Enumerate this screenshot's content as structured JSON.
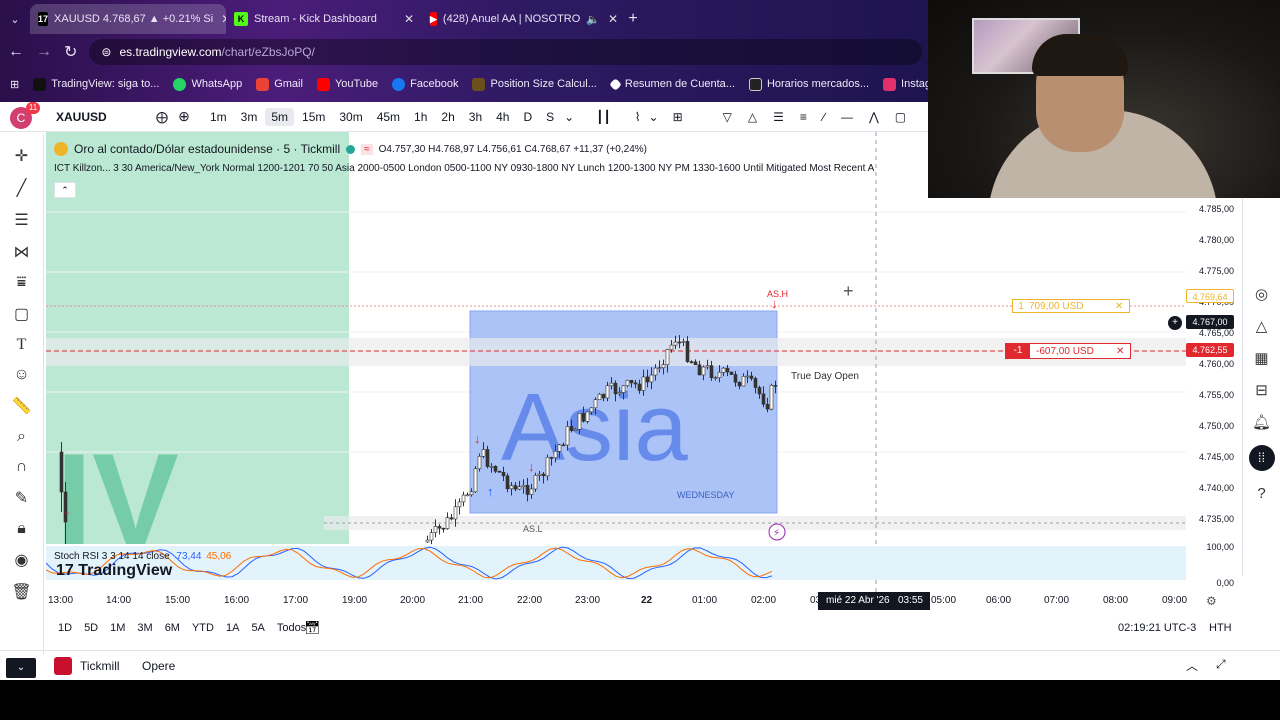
{
  "browser": {
    "tabs": [
      {
        "label": "XAUUSD 4.768,67 ▲ +0.21% Si",
        "icon": "TV",
        "active": true
      },
      {
        "label": "Stream - Kick Dashboard",
        "icon": "K",
        "active": false
      },
      {
        "label": "(428) Anuel AA | NOSOTRO",
        "icon": "YT",
        "active": false
      }
    ],
    "url_host": "es.tradingview.com",
    "url_path": "/chart/eZbsJoPQ/",
    "bookmarks": [
      {
        "label": "TradingView: siga to...",
        "icon": "tradingview-icon",
        "color": "#111111"
      },
      {
        "label": "WhatsApp",
        "icon": "whatsapp-icon",
        "color": "#25d366"
      },
      {
        "label": "Gmail",
        "icon": "gmail-icon",
        "color": "#ea4335"
      },
      {
        "label": "YouTube",
        "icon": "youtube-icon",
        "color": "#ff0000"
      },
      {
        "label": "Facebook",
        "icon": "facebook-icon",
        "color": "#1877f2"
      },
      {
        "label": "Position Size Calcul...",
        "icon": "fx-icon",
        "color": "#6b4f1d"
      },
      {
        "label": "Resumen de Cuenta...",
        "icon": "diamond-icon",
        "color": "#333333"
      },
      {
        "label": "Horarios mercados...",
        "icon": "inv-icon",
        "color": "#222222"
      },
      {
        "label": "Instagram",
        "icon": "instagram-icon",
        "color": "#e1306c"
      }
    ]
  },
  "toolbar": {
    "notif_count": "11",
    "avatar_letter": "C",
    "symbol": "XAUUSD",
    "timeframes": [
      "1m",
      "3m",
      "5m",
      "15m",
      "30m",
      "45m",
      "1h",
      "2h",
      "3h",
      "4h",
      "D",
      "S"
    ],
    "selected_timeframe": "5m"
  },
  "legend": {
    "title": "Oro al contado/Dólar estadounidense · 5 · Tickmill",
    "ohlc": "O4.757,30 H4.768,97 L4.756,61 C4.768,67 +11,37 (+0,24%)",
    "indicator": "ICT Killzon... 3 30 America/New_York Normal 1200-1201 70 50 Asia 2000-0500 London 0500-1100 NY 0930-1800 NY Lunch 1200-1300 NY PM 1330-1600 Until Mitigated Most Recent A"
  },
  "chart_labels": {
    "session_name": "Asia",
    "session_day": "WEDNESDAY",
    "asia_high": "AS.H",
    "asia_low": "AS.L",
    "true_day_open": "True Day Open",
    "watermark": "TradingView",
    "stoch_label": "Stoch RSI 3 3 14 14 close",
    "stoch_k": "73,44",
    "stoch_d": "45,06"
  },
  "positions": [
    {
      "qty": "1",
      "pnl": "709,00 USD",
      "color": "#f0b429"
    },
    {
      "qty": "-1",
      "pnl": "-607,00 USD",
      "color": "#e0282e"
    }
  ],
  "price_axis": [
    "4.785,00",
    "4.780,00",
    "4.775,00",
    "4.770,00",
    "4.765,00",
    "4.760,00",
    "4.755,00",
    "4.750,00",
    "4.745,00",
    "4.740,00",
    "4.735,00"
  ],
  "price_tags": {
    "tp": "4.769,64",
    "current": "4.767,00",
    "sl": "4.762,55",
    "hidden": "4.768,67",
    "hidden2": "4.765,00"
  },
  "stoch_axis": [
    "100,00",
    "0,00"
  ],
  "time_axis": [
    "13:00",
    "14:00",
    "15:00",
    "16:00",
    "17:00",
    "19:00",
    "20:00",
    "21:00",
    "22:00",
    "23:00",
    "22",
    "01:00",
    "02:00",
    "03",
    "05:00",
    "06:00",
    "07:00",
    "08:00",
    "09:00"
  ],
  "crosshair_date": "mié 22 Abr '26   03:55",
  "ranges": [
    "1D",
    "5D",
    "1M",
    "3M",
    "6M",
    "YTD",
    "1A",
    "5A",
    "Todos"
  ],
  "clock": "02:19:21 UTC-3",
  "session_mode": "HTH",
  "broker": {
    "name": "Tickmill",
    "action": "Opere"
  }
}
